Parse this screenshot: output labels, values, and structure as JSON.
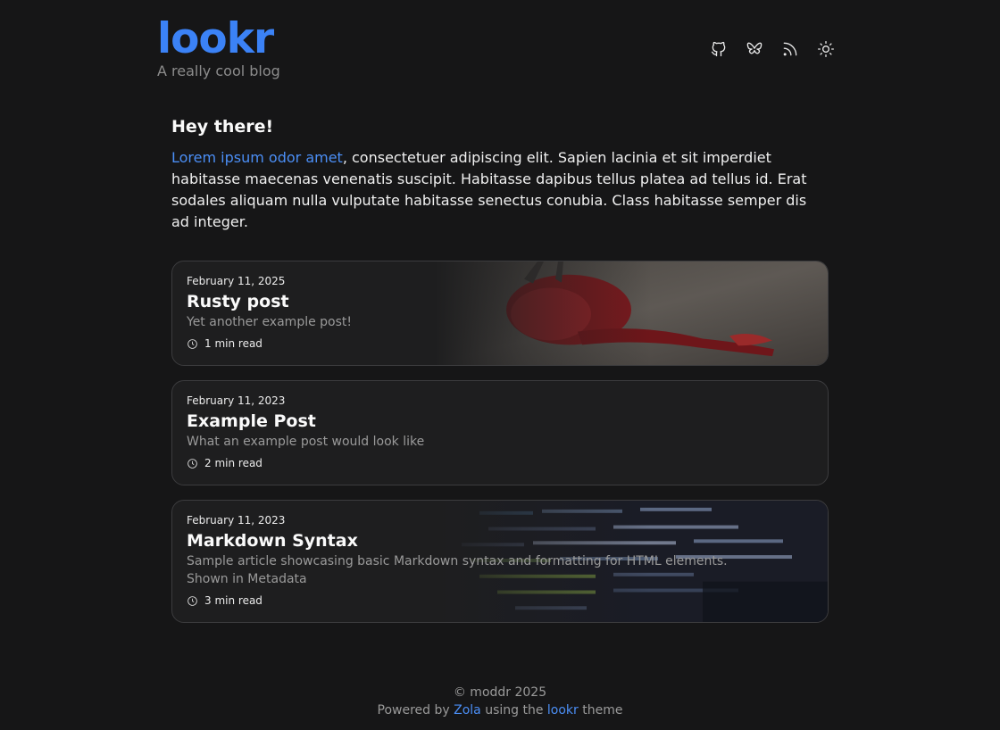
{
  "header": {
    "title": "lookr",
    "tagline": "A really cool blog",
    "icons": [
      "github-icon",
      "bluesky-icon",
      "rss-icon",
      "theme-toggle-sun-icon"
    ]
  },
  "intro": {
    "heading": "Hey there!",
    "link_text": "Lorem ipsum odor amet",
    "text": ", consectetuer adipiscing elit. Sapien lacinia et sit imperdiet habitasse maecenas venenatis suscipit. Habitasse dapibus tellus platea ad tellus id. Erat sodales aliquam nulla vulputate habitasse senectus conubia. Class habitasse semper dis ad integer."
  },
  "posts": [
    {
      "date": "February 11, 2025",
      "title": "Rusty post",
      "description": "Yet another example post!",
      "read_time": "1 min read",
      "image": "red crab on sand"
    },
    {
      "date": "February 11, 2023",
      "title": "Example Post",
      "description": "What an example post would look like",
      "read_time": "2 min read"
    },
    {
      "date": "February 11, 2023",
      "title": "Markdown Syntax",
      "description": "Sample article showcasing basic Markdown syntax and formatting for HTML elements. Shown in Metadata",
      "read_time": "3 min read",
      "image": "code on a dark screen"
    }
  ],
  "footer": {
    "copyright": "© moddr 2025",
    "powered_prefix": "Powered by",
    "engine": "Zola",
    "using_text": "using the",
    "theme_name": "lookr",
    "theme_suffix": "theme"
  },
  "colors": {
    "background": "#161617",
    "accent": "#3b82f6",
    "card": "#1e1e1f",
    "border": "#3c3c3e"
  }
}
